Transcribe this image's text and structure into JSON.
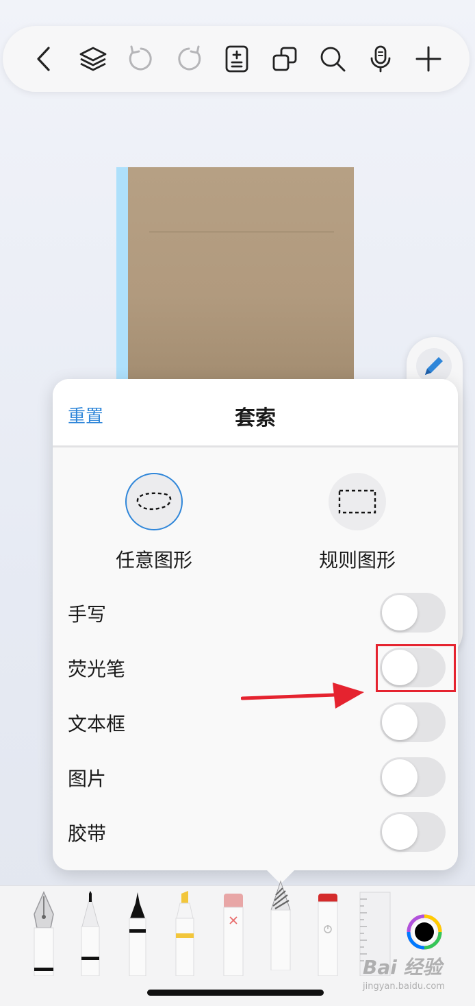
{
  "toolbar": {
    "icons": [
      "back-icon",
      "layers-icon",
      "undo-icon",
      "redo-icon",
      "page-add-icon",
      "duplicate-icon",
      "search-icon",
      "microphone-icon",
      "add-icon"
    ]
  },
  "popover": {
    "reset_label": "重置",
    "title": "套索",
    "modes": [
      {
        "label": "任意图形",
        "selected": true
      },
      {
        "label": "规则图形",
        "selected": false
      }
    ],
    "options": [
      {
        "label": "手写",
        "on": false
      },
      {
        "label": "荧光笔",
        "on": false
      },
      {
        "label": "文本框",
        "on": false
      },
      {
        "label": "图片",
        "on": false
      },
      {
        "label": "胶带",
        "on": false
      }
    ]
  },
  "tray": {
    "tools": [
      "fountain-pen-icon",
      "ballpoint-pen-icon",
      "brush-pen-icon",
      "highlighter-icon",
      "eraser-icon",
      "lasso-tool-icon",
      "tape-icon",
      "ruler-icon",
      "color-picker-icon"
    ]
  },
  "watermark": {
    "main": "Bai 经验",
    "sub": "jingyan.baidu.com"
  },
  "colors": {
    "accent": "#2f86d9",
    "annotation": "#e5232f",
    "notebook": "#b6a084",
    "spine": "#aee0fb"
  }
}
